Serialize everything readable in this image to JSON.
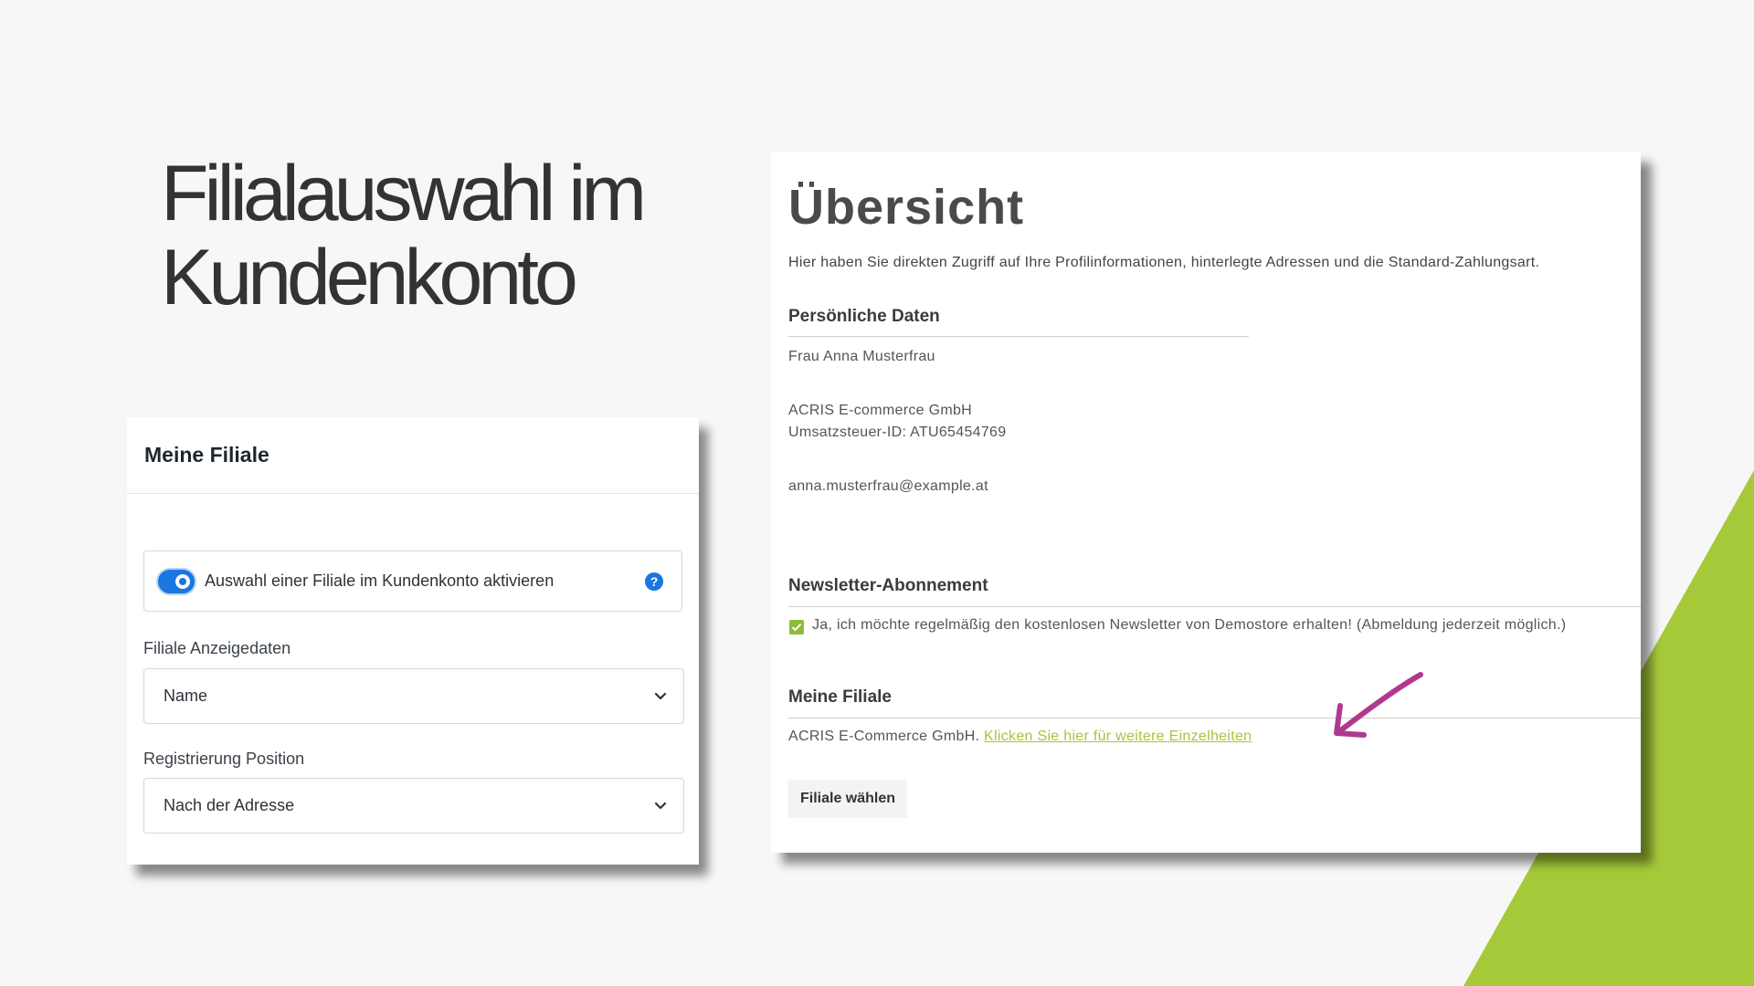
{
  "slide": {
    "title_line1": "Filialauswahl im",
    "title_line2": "Kundenkonto",
    "accent_color": "#a6c93a"
  },
  "settings": {
    "header": "Meine Filiale",
    "toggle": {
      "label": "Auswahl einer Filiale im Kundenkonto aktivieren",
      "enabled": true,
      "help_icon": "question-circle-icon"
    },
    "fields": [
      {
        "label": "Filiale Anzeigedaten",
        "value": "Name"
      },
      {
        "label": "Registrierung Position",
        "value": "Nach der Adresse"
      }
    ]
  },
  "overview": {
    "title": "Übersicht",
    "intro": "Hier haben Sie direkten Zugriff auf Ihre Profilinformationen, hinterlegte Adressen und die Standard-Zahlungsart.",
    "personal": {
      "heading": "Persönliche Daten",
      "name": "Frau Anna Musterfrau",
      "company": "ACRIS E-commerce GmbH",
      "vat": "Umsatzsteuer-ID: ATU65454769",
      "email": "anna.musterfrau@example.at"
    },
    "newsletter": {
      "heading": "Newsletter-Abonnement",
      "checked": true,
      "text": "Ja, ich möchte regelmäßig den kostenlosen Newsletter von Demostore erhalten! (Abmeldung jederzeit möglich.)"
    },
    "store": {
      "heading": "Meine Filiale",
      "name": "ACRIS E-Commerce GmbH.",
      "link": "Klicken Sie hier für weitere Einzelheiten",
      "button": "Filiale wählen"
    },
    "link_color": "#a6c63a",
    "arrow_color": "#b0398f"
  }
}
